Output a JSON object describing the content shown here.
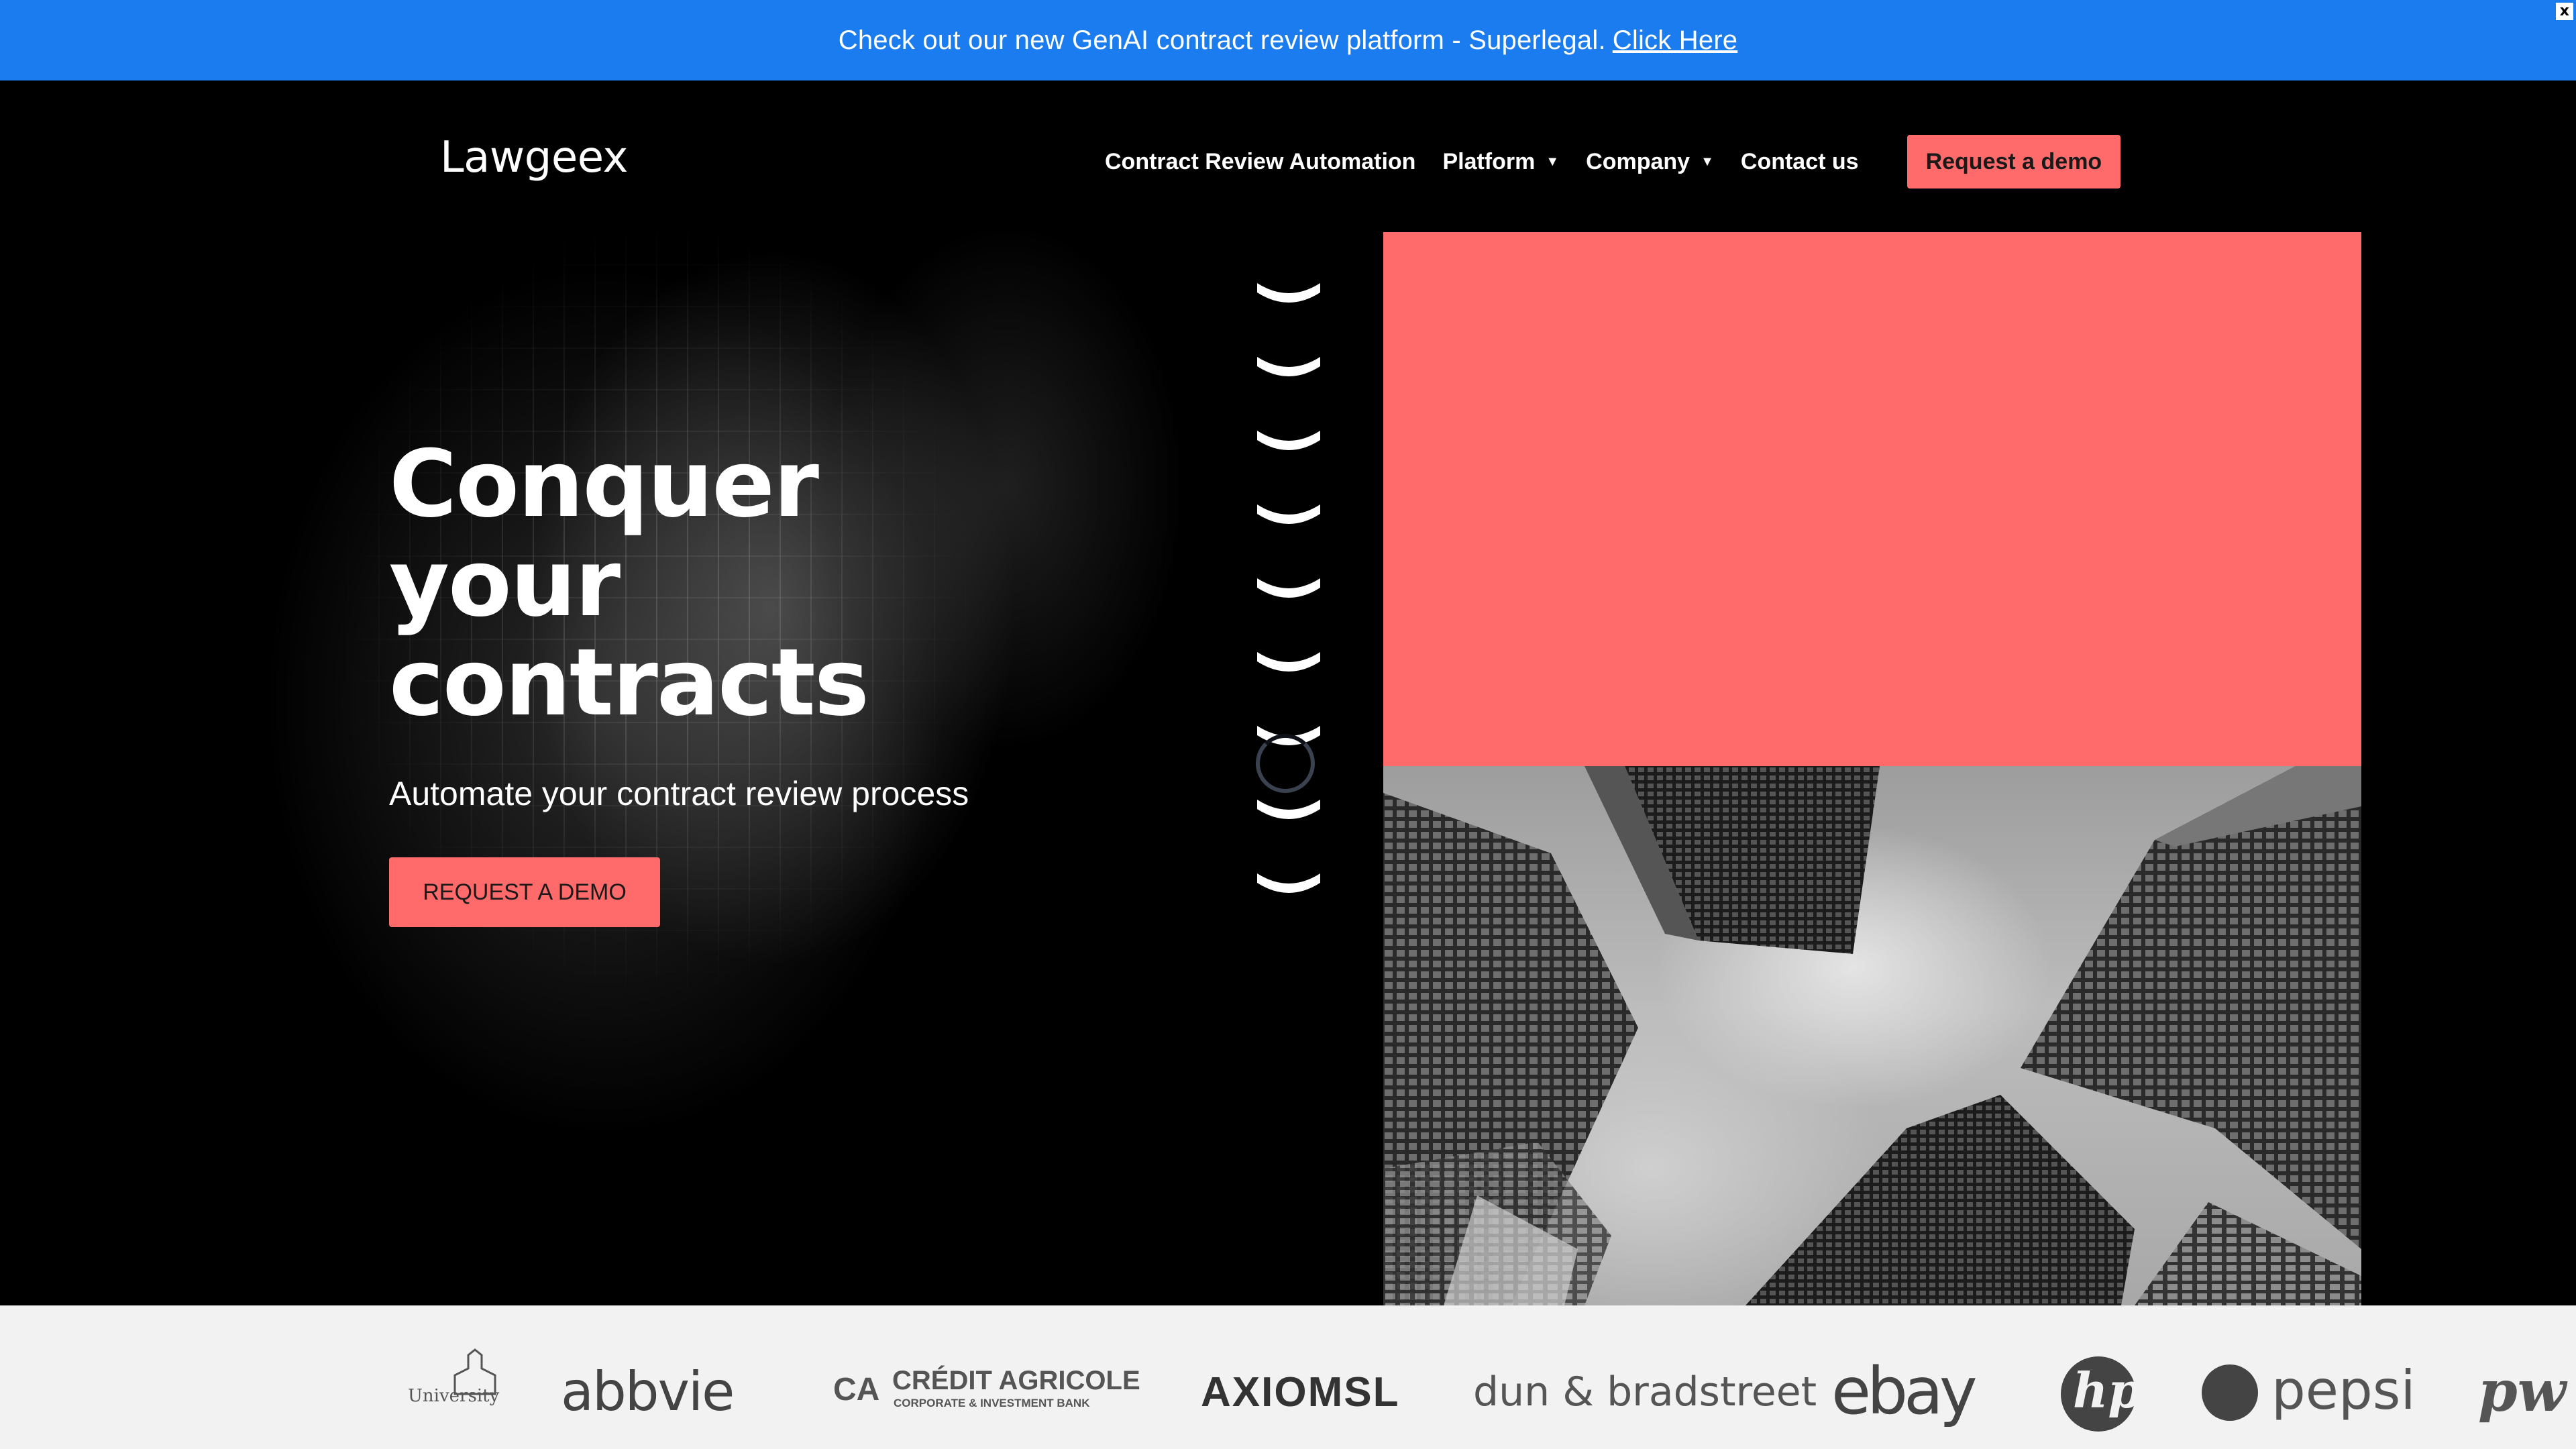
{
  "announcement": {
    "text": "Check out our new GenAI contract review platform - Superlegal.",
    "link": "Click Here",
    "close": "x"
  },
  "header": {
    "logo": "Lawgeex",
    "nav": [
      {
        "label": "Contract Review Automation",
        "dropdown": false
      },
      {
        "label": "Platform",
        "dropdown": true
      },
      {
        "label": "Company",
        "dropdown": true
      },
      {
        "label": "Contact us",
        "dropdown": false
      }
    ],
    "cta": "Request a demo"
  },
  "hero": {
    "title_lines": [
      "Conquer",
      "your",
      "contracts"
    ],
    "subtitle": "Automate your contract review process",
    "button": "REQUEST A DEMO"
  },
  "colors": {
    "announcement_bg": "#1b7cf0",
    "accent": "#ff6b6b",
    "page_bg": "#000000",
    "logos_bg": "#f2f2f2"
  },
  "client_logos": [
    {
      "name": "University of San Diego",
      "icon": "university-logo"
    },
    {
      "name": "abbvie"
    },
    {
      "name": "CRÉDIT AGRICOLE",
      "sub": "CORPORATE & INVESTMENT BANK"
    },
    {
      "name": "AXIOMSL"
    },
    {
      "name": "dun & bradstreet"
    },
    {
      "name": "ebay"
    },
    {
      "name": "hp"
    },
    {
      "name": "pepsi"
    },
    {
      "name": "pw"
    }
  ]
}
